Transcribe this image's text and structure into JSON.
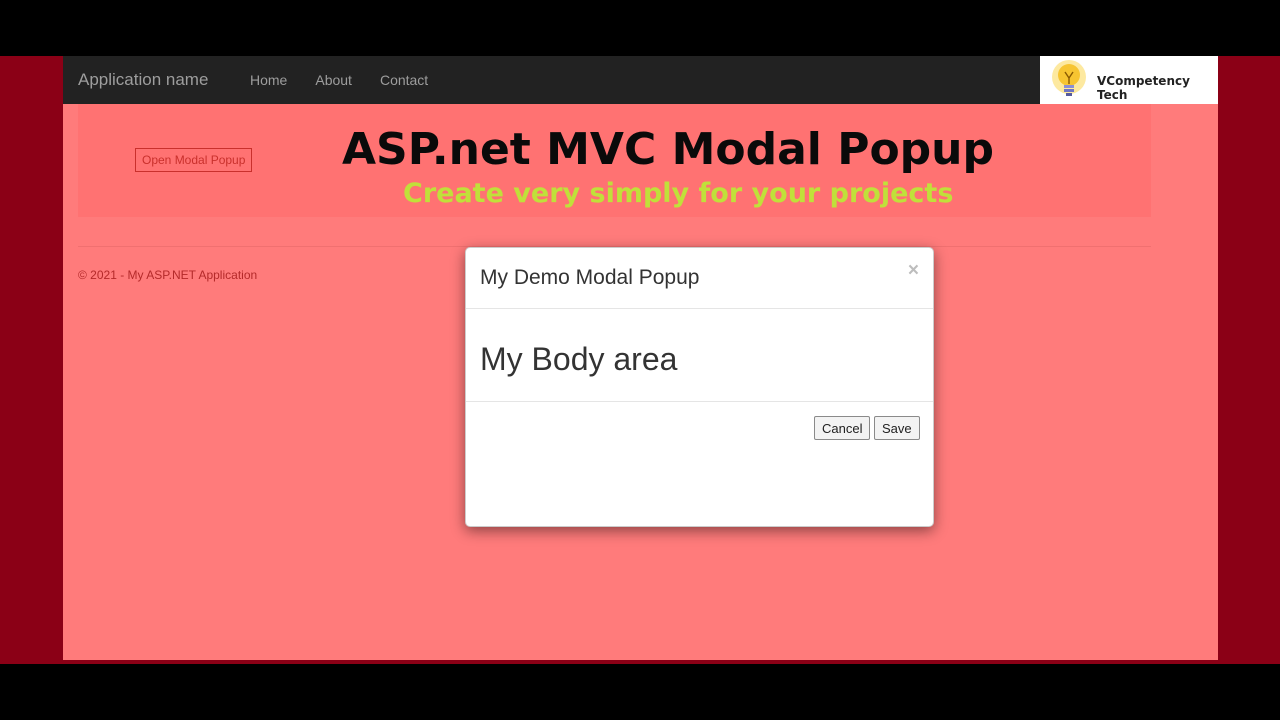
{
  "navbar": {
    "brand": "Application name",
    "links": [
      "Home",
      "About",
      "Contact"
    ]
  },
  "logo": {
    "text": "VCompetency Tech",
    "icon": "lightbulb-icon"
  },
  "jumbotron": {
    "open_button": "Open Modal Popup",
    "title": "ASP.net MVC Modal Popup",
    "subtitle": "Create very simply for your projects"
  },
  "footer": {
    "copyright": "© 2021 - My ASP.NET Application"
  },
  "modal": {
    "title": "My Demo Modal Popup",
    "close": "×",
    "body": "My Body area",
    "cancel_label": "Cancel",
    "save_label": "Save"
  },
  "colors": {
    "frame": "#8b0016",
    "page_bg": "#ff7b7b",
    "navbar_bg": "#222222",
    "subtitle": "#c0e03a",
    "danger": "#c9302c"
  }
}
